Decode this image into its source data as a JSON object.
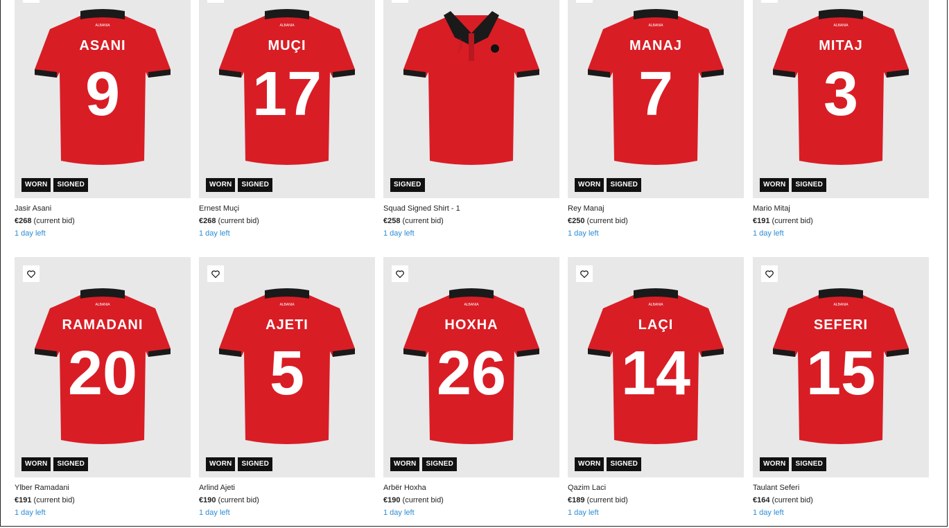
{
  "colors": {
    "shirt_red": "#d91d25",
    "collar_black": "#1a1a1a",
    "badge_bg": "#111111",
    "link_blue": "#2a8bd6",
    "thumb_bg": "#e8e8e8"
  },
  "shirt_crest_text": "ALBANIA",
  "items": [
    {
      "title": "Jasir Asani",
      "price": "€268",
      "bid_note": "(current bid)",
      "time_left": "1 day left",
      "shirt_name": "ASANI",
      "shirt_number": "9",
      "badges": [
        "WORN",
        "SIGNED"
      ]
    },
    {
      "title": "Ernest Muçi",
      "price": "€268",
      "bid_note": "(current bid)",
      "time_left": "1 day left",
      "shirt_name": "MUÇI",
      "shirt_number": "17",
      "badges": [
        "WORN",
        "SIGNED"
      ]
    },
    {
      "title": "Squad Signed Shirt - 1",
      "price": "€258",
      "bid_note": "(current bid)",
      "time_left": "1 day left",
      "shirt_name": "",
      "shirt_number": "",
      "badges": [
        "SIGNED"
      ]
    },
    {
      "title": "Rey Manaj",
      "price": "€250",
      "bid_note": "(current bid)",
      "time_left": "1 day left",
      "shirt_name": "MANAJ",
      "shirt_number": "7",
      "badges": [
        "WORN",
        "SIGNED"
      ]
    },
    {
      "title": "Mario Mitaj",
      "price": "€191",
      "bid_note": "(current bid)",
      "time_left": "1 day left",
      "shirt_name": "MITAJ",
      "shirt_number": "3",
      "badges": [
        "WORN",
        "SIGNED"
      ]
    },
    {
      "title": "Ylber Ramadani",
      "price": "€191",
      "bid_note": "(current bid)",
      "time_left": "1 day left",
      "shirt_name": "RAMADANI",
      "shirt_number": "20",
      "badges": [
        "WORN",
        "SIGNED"
      ]
    },
    {
      "title": "Arlind Ajeti",
      "price": "€190",
      "bid_note": "(current bid)",
      "time_left": "1 day left",
      "shirt_name": "AJETI",
      "shirt_number": "5",
      "badges": [
        "WORN",
        "SIGNED"
      ]
    },
    {
      "title": "Arbër Hoxha",
      "price": "€190",
      "bid_note": "(current bid)",
      "time_left": "1 day left",
      "shirt_name": "HOXHA",
      "shirt_number": "26",
      "badges": [
        "WORN",
        "SIGNED"
      ]
    },
    {
      "title": "Qazim Laci",
      "price": "€189",
      "bid_note": "(current bid)",
      "time_left": "1 day left",
      "shirt_name": "LAÇI",
      "shirt_number": "14",
      "badges": [
        "WORN",
        "SIGNED"
      ]
    },
    {
      "title": "Taulant Seferi",
      "price": "€164",
      "bid_note": "(current bid)",
      "time_left": "1 day left",
      "shirt_name": "SEFERI",
      "shirt_number": "15",
      "badges": [
        "WORN",
        "SIGNED"
      ]
    }
  ]
}
